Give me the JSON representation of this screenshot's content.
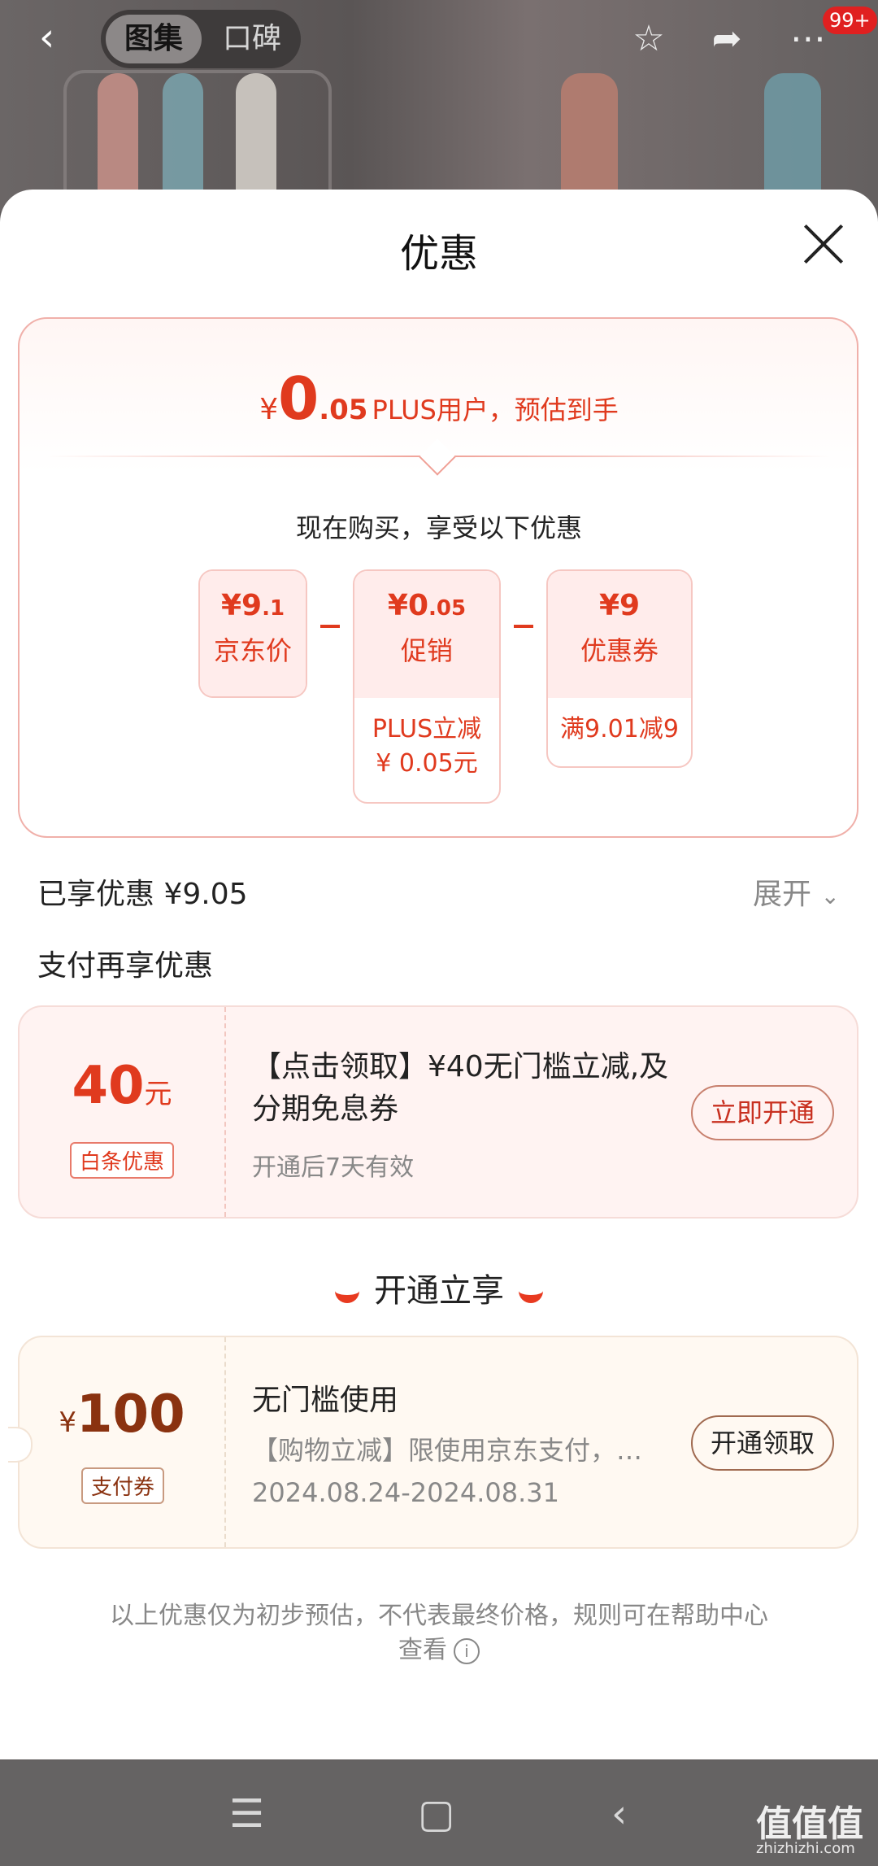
{
  "topbar": {
    "tabs": [
      "图集",
      "口碑"
    ],
    "badge": "99+"
  },
  "sheet": {
    "title": "优惠"
  },
  "estimate": {
    "currency": "¥",
    "integer": "0",
    "decimal": ".05",
    "label": "PLUS用户，预估到手"
  },
  "breakdown": {
    "subtitle": "现在购买，享受以下优惠",
    "items": [
      {
        "value_main": "¥9",
        "value_dec": ".1",
        "label": "京东价"
      },
      {
        "value_main": "¥0",
        "value_dec": ".05",
        "label": "促销",
        "detail_line1": "PLUS立减",
        "detail_line2": "¥ 0.05元"
      },
      {
        "value_main": "¥9",
        "value_dec": "",
        "label": "优惠券",
        "detail_line1": "满9.01减9"
      }
    ]
  },
  "enjoyed": {
    "label": "已享优惠 ¥9.05",
    "expand": "展开"
  },
  "pay_again": {
    "title": "支付再享优惠",
    "baitiao": {
      "amount": "40",
      "unit": "元",
      "tag": "白条优惠",
      "title": "【点击领取】¥40无门槛立减,及分期免息券",
      "subtitle": "开通后7天有效",
      "button": "立即开通"
    }
  },
  "open_enjoy": {
    "title": "开通立享",
    "coupon": {
      "currency": "¥",
      "amount": "100",
      "tag": "支付券",
      "title": "无门槛使用",
      "desc": "【购物立减】限使用京东支付，…",
      "dates": "2024.08.24-2024.08.31",
      "button": "开通领取"
    }
  },
  "footer": {
    "note": "以上优惠仅为初步预估，不代表最终价格，规则可在帮助中心查看"
  },
  "watermark": {
    "logo": "值值值",
    "url": "zhizhizhi.com"
  },
  "colors": {
    "accent": "#e03a1e",
    "coupon_brown": "#8a3210"
  }
}
